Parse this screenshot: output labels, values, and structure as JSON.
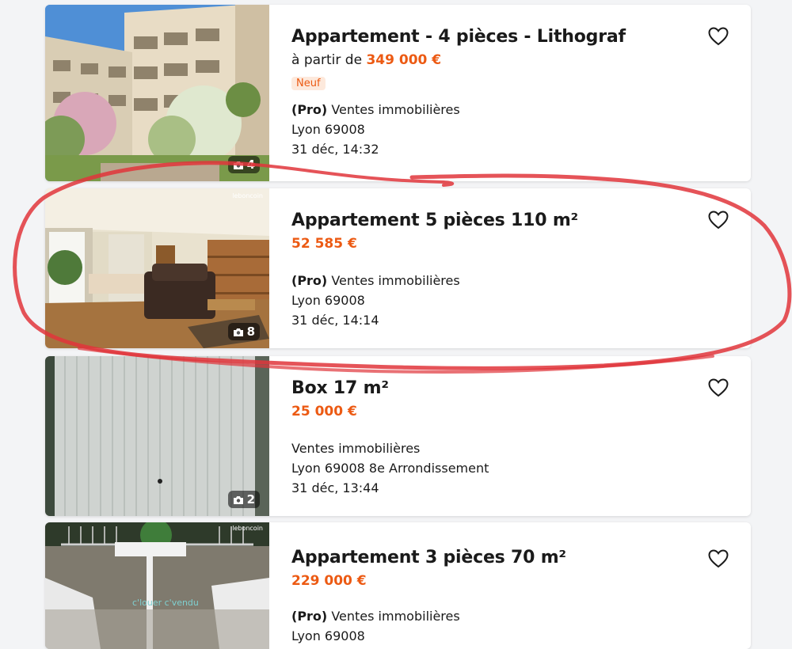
{
  "listings": [
    {
      "title": "Appartement - 4 pièces - Lithograf",
      "price_prefix": "à partir de ",
      "price": "349 000 €",
      "badge": "Neuf",
      "seller_type": "(Pro)",
      "category": "Ventes immobilières",
      "location": "Lyon 69008",
      "date": "31 déc, 14:32",
      "photo_count": "4"
    },
    {
      "title": "Appartement 5 pièces 110 m²",
      "price": "52 585 €",
      "seller_type": "(Pro)",
      "category": "Ventes immobilières",
      "location": "Lyon 69008",
      "date": "31 déc, 14:14",
      "photo_count": "8",
      "watermark": "leboncoin"
    },
    {
      "title": "Box 17 m²",
      "price": "25 000 €",
      "category": "Ventes immobilières",
      "location": "Lyon 69008 8e Arrondissement",
      "date": "31 déc, 13:44",
      "photo_count": "2"
    },
    {
      "title": "Appartement 3 pièces 70 m²",
      "price": "229 000 €",
      "seller_type": "(Pro)",
      "category": "Ventes immobilières",
      "location": "Lyon 69008",
      "watermark": "leboncoin",
      "photo_overlay_text": "c'louer c'vendu"
    }
  ],
  "colors": {
    "price": "#ec5a13",
    "badge_bg": "#fde9dc",
    "annotation": "#e0353b"
  },
  "icons": {
    "favorite": "heart-outline-icon",
    "photos": "camera-icon"
  }
}
